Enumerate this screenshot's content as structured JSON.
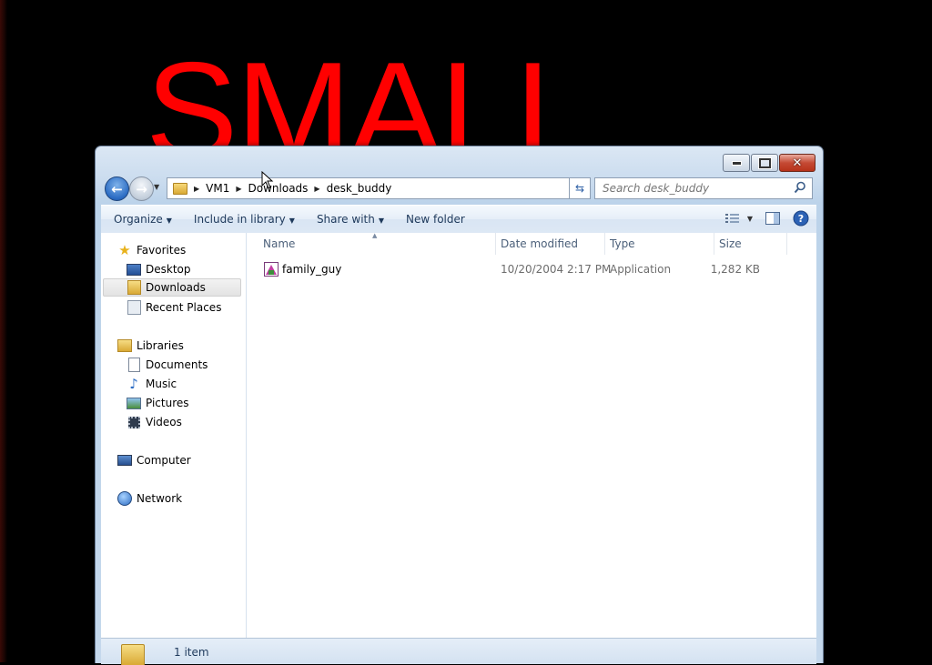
{
  "background": {
    "big_text": "SMALL",
    "accent": "#ff0000"
  },
  "window": {
    "caption_buttons": {
      "minimize": "minimize-icon",
      "maximize": "maximize-icon",
      "close": "close-icon"
    },
    "breadcrumb": [
      "VM1",
      "Downloads",
      "desk_buddy"
    ],
    "search": {
      "placeholder": "Search desk_buddy"
    },
    "toolbar": {
      "organize": "Organize",
      "include_in_library": "Include in library",
      "share_with": "Share with",
      "new_folder": "New folder"
    },
    "nav_pane": {
      "favorites": "Favorites",
      "desktop": "Desktop",
      "downloads": "Downloads",
      "recent_places": "Recent Places",
      "libraries": "Libraries",
      "documents": "Documents",
      "music": "Music",
      "pictures": "Pictures",
      "videos": "Videos",
      "computer": "Computer",
      "network": "Network"
    },
    "columns": {
      "name": "Name",
      "date_modified": "Date modified",
      "type": "Type",
      "size": "Size"
    },
    "files": [
      {
        "name": "family_guy",
        "date_modified": "10/20/2004 2:17 PM",
        "type": "Application",
        "size": "1,282 KB"
      }
    ],
    "status": {
      "item_count": "1 item"
    }
  }
}
